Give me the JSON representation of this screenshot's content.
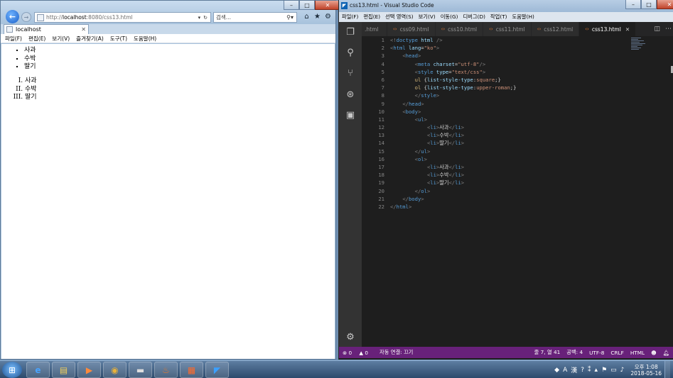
{
  "ie": {
    "url_prefix": "http://",
    "url_host": "localhost",
    "url_rest": ":8080/css13.html",
    "search_placeholder": "검색...",
    "tab_title": "localhost",
    "menu": [
      "파일(F)",
      "편집(E)",
      "보기(V)",
      "즐겨찾기(A)",
      "도구(T)",
      "도움말(H)"
    ],
    "content": {
      "ul_items": [
        "사과",
        "수박",
        "딸기"
      ],
      "ol_items": [
        "사과",
        "수박",
        "딸기"
      ]
    }
  },
  "vscode": {
    "title": "css13.html - Visual Studio Code",
    "menu": [
      "파일(F)",
      "편집(E)",
      "선택 영역(S)",
      "보기(V)",
      "이동(G)",
      "디버그(D)",
      "작업(T)",
      "도움말(H)"
    ],
    "tabs": [
      ".html",
      "css09.html",
      "css10.html",
      "css11.html",
      "css12.html",
      "css13.html"
    ],
    "active_tab": "css13.html",
    "line_numbers": [
      "1",
      "2",
      "3",
      "4",
      "5",
      "6",
      "7",
      "8",
      "9",
      "10",
      "11",
      "12",
      "13",
      "14",
      "15",
      "16",
      "17",
      "18",
      "19",
      "20",
      "21",
      "22"
    ],
    "status": {
      "problems": "0",
      "warnings": "0",
      "live": "자동 연결: 끄기",
      "position": "줄 7, 열 41",
      "spaces": "공백: 4",
      "encoding": "UTF-8",
      "eol": "CRLF",
      "language": "HTML"
    }
  },
  "taskbar": {
    "time": "오후 1:08",
    "date": "2018-05-16",
    "ime": "A",
    "ime_hanja": "漢"
  }
}
